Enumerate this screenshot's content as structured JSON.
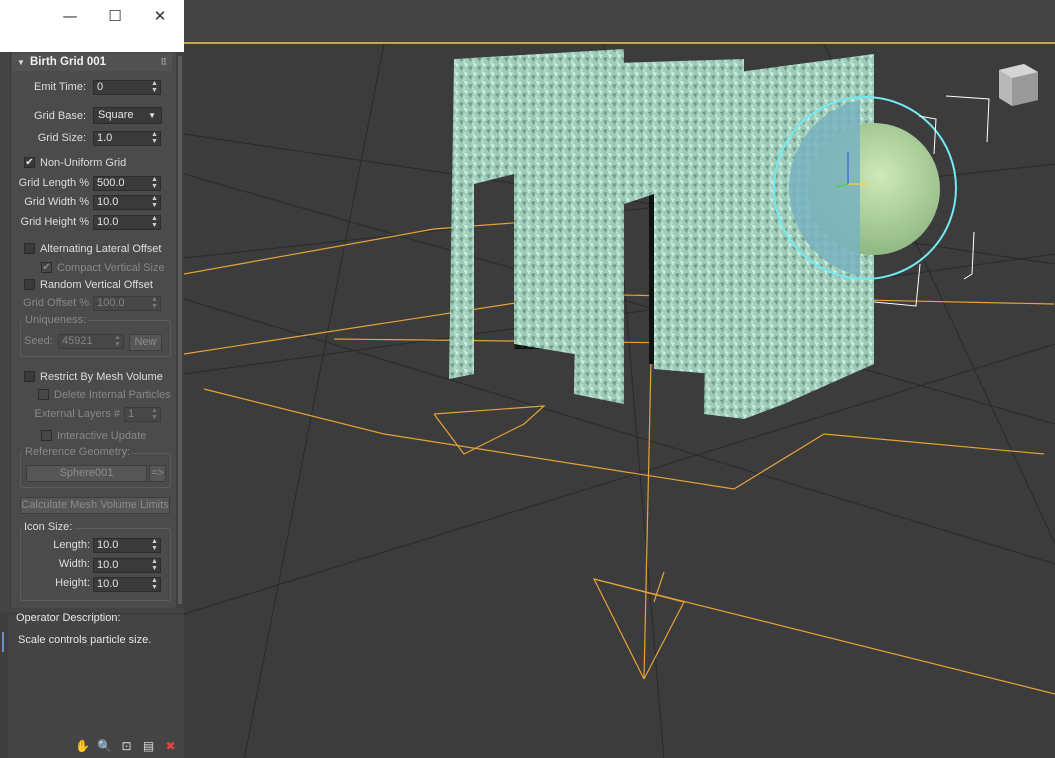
{
  "window": {
    "minimize": "—",
    "maximize": "☐",
    "close": "✕"
  },
  "rollout": {
    "title": "Birth Grid 001",
    "emit_time": {
      "label": "Emit Time:",
      "value": "0"
    },
    "grid_base": {
      "label": "Grid Base:",
      "value": "Square"
    },
    "grid_size": {
      "label": "Grid Size:",
      "value": "1.0"
    },
    "non_uniform": {
      "label": "Non-Uniform Grid",
      "checked": true
    },
    "grid_length": {
      "label": "Grid Length %",
      "value": "500.0"
    },
    "grid_width": {
      "label": "Grid Width %",
      "value": "10.0"
    },
    "grid_height": {
      "label": "Grid Height %",
      "value": "10.0"
    },
    "alt_lateral": {
      "label": "Alternating Lateral Offset",
      "checked": false
    },
    "compact_vertical": {
      "label": "Compact Vertical Size",
      "checked": true
    },
    "random_vertical": {
      "label": "Random Vertical Offset",
      "checked": false
    },
    "grid_offset": {
      "label": "Grid Offset %",
      "value": "100.0"
    },
    "uniqueness": {
      "title": "Uniqueness:",
      "seed_label": "Seed:",
      "seed_value": "45921",
      "new_button": "New"
    },
    "restrict_mesh": {
      "label": "Restrict By Mesh Volume",
      "checked": false
    },
    "delete_internal": {
      "label": "Delete Internal Particles",
      "checked": false
    },
    "external_layers": {
      "label": "External Layers #",
      "value": "1"
    },
    "interactive_update": {
      "label": "Interactive Update",
      "checked": false
    },
    "reference_geometry": {
      "title": "Reference Geometry:",
      "object": "Sphere001",
      "pick": "=>"
    },
    "calc_button": "Calculate Mesh Volume Limits",
    "icon_size": {
      "title": "Icon Size:",
      "length": {
        "label": "Length:",
        "value": "10.0"
      },
      "width": {
        "label": "Width:",
        "value": "10.0"
      },
      "height": {
        "label": "Height:",
        "value": "10.0"
      }
    }
  },
  "description": {
    "title": "Operator Description:",
    "text": "Scale controls particle size."
  },
  "tool_icons": [
    "pan-icon",
    "zoom-icon",
    "zoom-region-icon",
    "display-icon",
    "delete-icon"
  ],
  "colors": {
    "accent_orange": "#e6a13a",
    "foam": "#a4d4c0",
    "sphere_cyan": "#6fe9f2",
    "sphere_green": "#b5d9a3"
  }
}
